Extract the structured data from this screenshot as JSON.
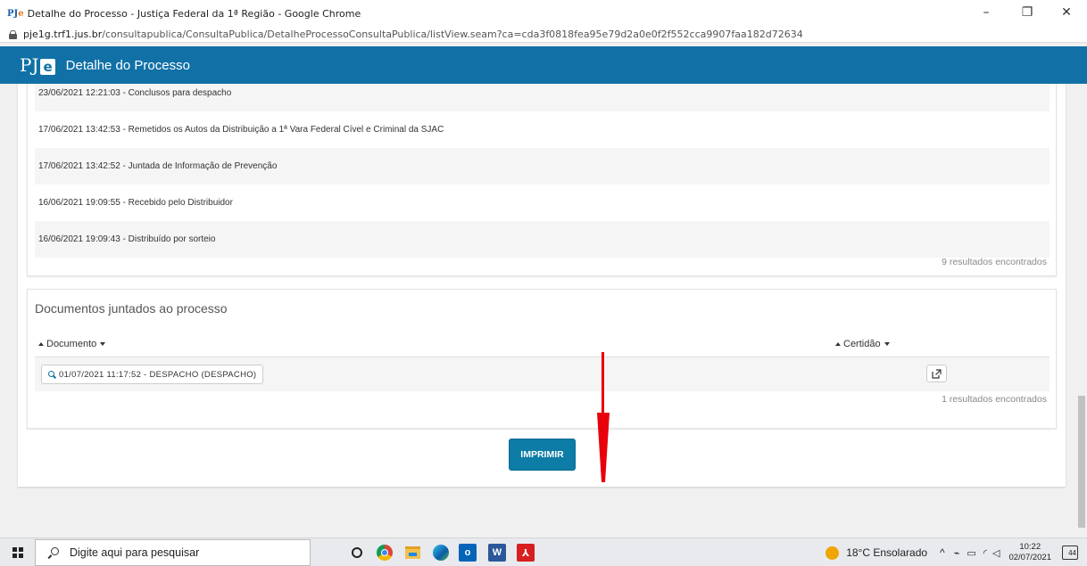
{
  "browser": {
    "tab_title": "Detalhe do Processo - Justiça Federal da 1ª Região - Google Chrome",
    "url_host": "pje1g.trf1.jus.br",
    "url_path": "/consultapublica/ConsultaPublica/DetalheProcessoConsultaPublica/listView.seam?ca=cda3f0818fea95e79d2a0e0f2f552cca9907faa182d72634",
    "controls": {
      "minimize": "–",
      "restore": "❐",
      "close": "✕"
    }
  },
  "app": {
    "logo_p": "PJ",
    "logo_e": "e",
    "title": "Detalhe do Processo",
    "brand_color": "#1171a6"
  },
  "movimentacoes": {
    "rows": [
      "23/06/2021 12:21:03 - Conclusos para despacho",
      "17/06/2021 13:42:53 - Remetidos os Autos da Distribuição a 1ª Vara Federal Cível e Criminal da SJAC",
      "17/06/2021 13:42:52 - Juntada de Informação de Prevenção",
      "16/06/2021 19:09:55 - Recebido pelo Distribuidor",
      "16/06/2021 19:09:43 - Distribuído por sorteio"
    ],
    "results": "9 resultados encontrados"
  },
  "documentos": {
    "heading": "Documentos juntados ao processo",
    "col_documento": "Documento",
    "col_certidao": "Certidão",
    "rows": [
      {
        "label": "01/07/2021 11:17:52 - DESPACHO (DESPACHO)"
      }
    ],
    "results": "1 resultados encontrados"
  },
  "actions": {
    "print_label": "IMPRIMIR"
  },
  "taskbar": {
    "search_placeholder": "Digite aqui para pesquisar",
    "weather": "18°C  Ensolarado",
    "time": "10:22",
    "date": "02/07/2021",
    "notifications": "44"
  }
}
